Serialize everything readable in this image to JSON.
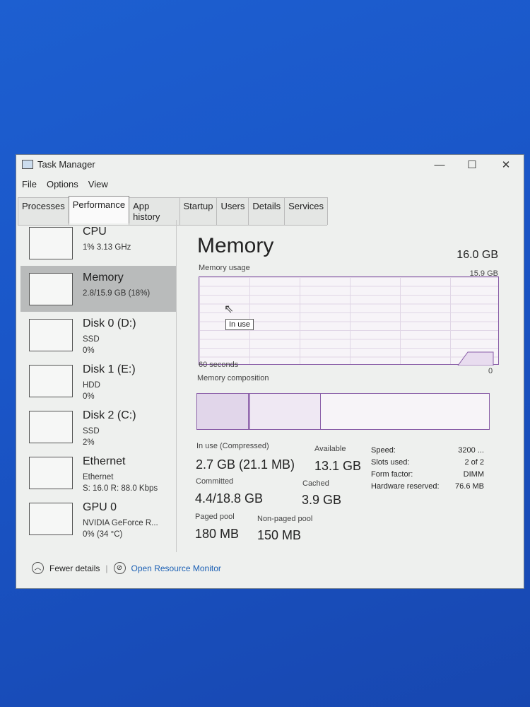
{
  "window": {
    "title": "Task Manager",
    "minimize": "—",
    "maximize": "☐",
    "close": "✕"
  },
  "menu": [
    "File",
    "Options",
    "View"
  ],
  "tabs": [
    "Processes",
    "Performance",
    "App history",
    "Startup",
    "Users",
    "Details",
    "Services"
  ],
  "active_tab": "Performance",
  "sidebar": [
    {
      "name": "CPU",
      "line1": "1% 3.13 GHz",
      "line2": ""
    },
    {
      "name": "Memory",
      "line1": "2.8/15.9 GB (18%)",
      "line2": "",
      "selected": true
    },
    {
      "name": "Disk 0 (D:)",
      "line1": "SSD",
      "line2": "0%"
    },
    {
      "name": "Disk 1 (E:)",
      "line1": "HDD",
      "line2": "0%"
    },
    {
      "name": "Disk 2 (C:)",
      "line1": "SSD",
      "line2": "2%"
    },
    {
      "name": "Ethernet",
      "line1": "Ethernet",
      "line2": "S: 16.0 R: 88.0 Kbps"
    },
    {
      "name": "GPU 0",
      "line1": "NVIDIA GeForce R...",
      "line2": "0% (34 °C)"
    }
  ],
  "main": {
    "title": "Memory",
    "total": "16.0 GB",
    "usage_label": "Memory usage",
    "usage_max": "15.9 GB",
    "time_label": "60 seconds",
    "zero": "0",
    "tooltip": "In use",
    "composition_label": "Memory composition",
    "stats": {
      "in_use_label": "In use (Compressed)",
      "in_use": "2.7 GB (21.1 MB)",
      "available_label": "Available",
      "available": "13.1 GB",
      "committed_label": "Committed",
      "committed": "4.4/18.8 GB",
      "cached_label": "Cached",
      "cached": "3.9 GB",
      "paged_label": "Paged pool",
      "paged": "180 MB",
      "nonpaged_label": "Non-paged pool",
      "nonpaged": "150 MB"
    },
    "specs": [
      {
        "k": "Speed:",
        "v": "3200 ..."
      },
      {
        "k": "Slots used:",
        "v": "2 of 2"
      },
      {
        "k": "Form factor:",
        "v": "DIMM"
      },
      {
        "k": "Hardware reserved:",
        "v": "76.6 MB"
      }
    ]
  },
  "footer": {
    "fewer": "Fewer details",
    "monitor": "Open Resource Monitor"
  },
  "colors": {
    "accent": "#8a5ea8",
    "link": "#1a5fb4",
    "desktop": "#1a56c8"
  }
}
